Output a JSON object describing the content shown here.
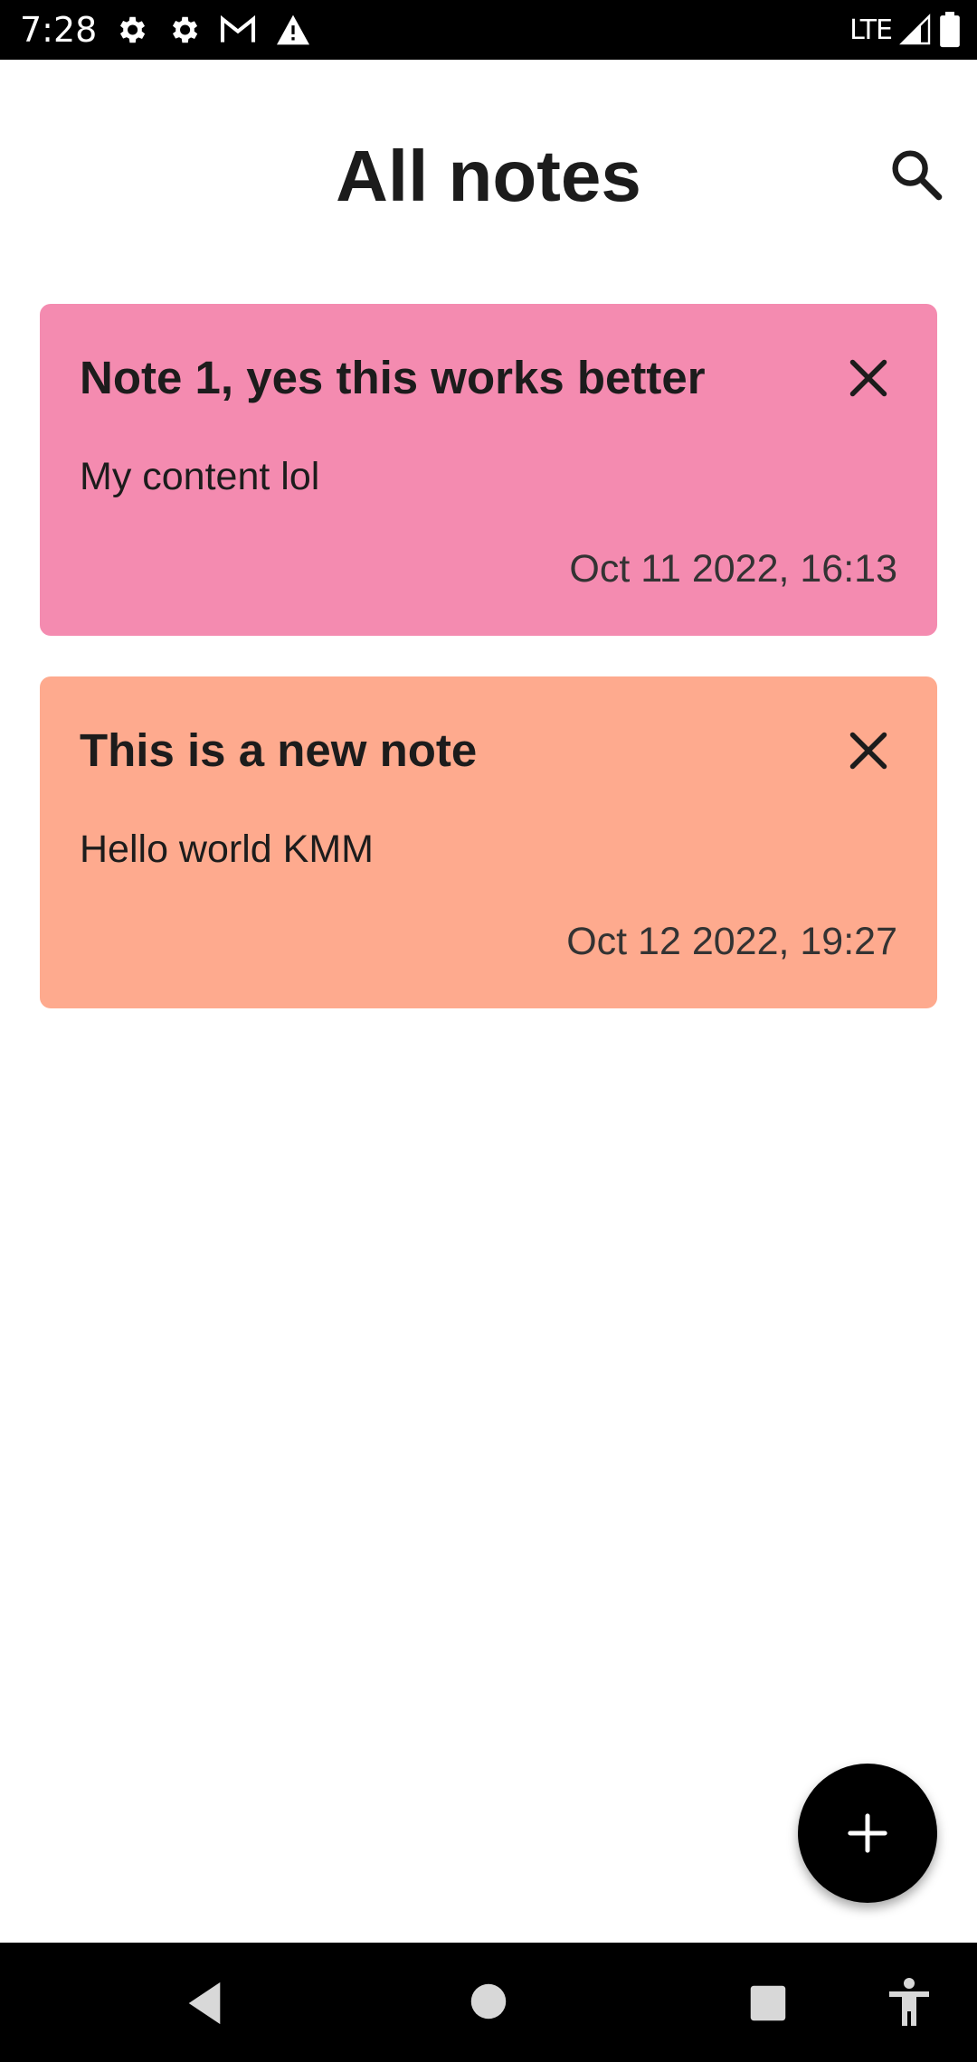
{
  "status_bar": {
    "time": "7:28",
    "network": "LTE",
    "icons_left": [
      "settings-icon",
      "settings-icon",
      "gmail-icon",
      "warning-icon"
    ],
    "icons_right": [
      "signal-icon",
      "battery-icon"
    ]
  },
  "header": {
    "title": "All notes",
    "search_icon": "search-icon"
  },
  "notes": [
    {
      "title": "Note 1, yes this works better",
      "content": "My content lol",
      "date": "Oct 11 2022, 16:13",
      "color": "#F48BB0"
    },
    {
      "title": "This is a new note",
      "content": "Hello world KMM",
      "date": "Oct 12 2022, 19:27",
      "color": "#FEAA8E"
    }
  ],
  "fab": {
    "icon": "plus-icon",
    "color": "#000000"
  },
  "nav_bar": {
    "icons": [
      "back-icon",
      "home-icon",
      "recents-icon",
      "accessibility-icon"
    ]
  }
}
